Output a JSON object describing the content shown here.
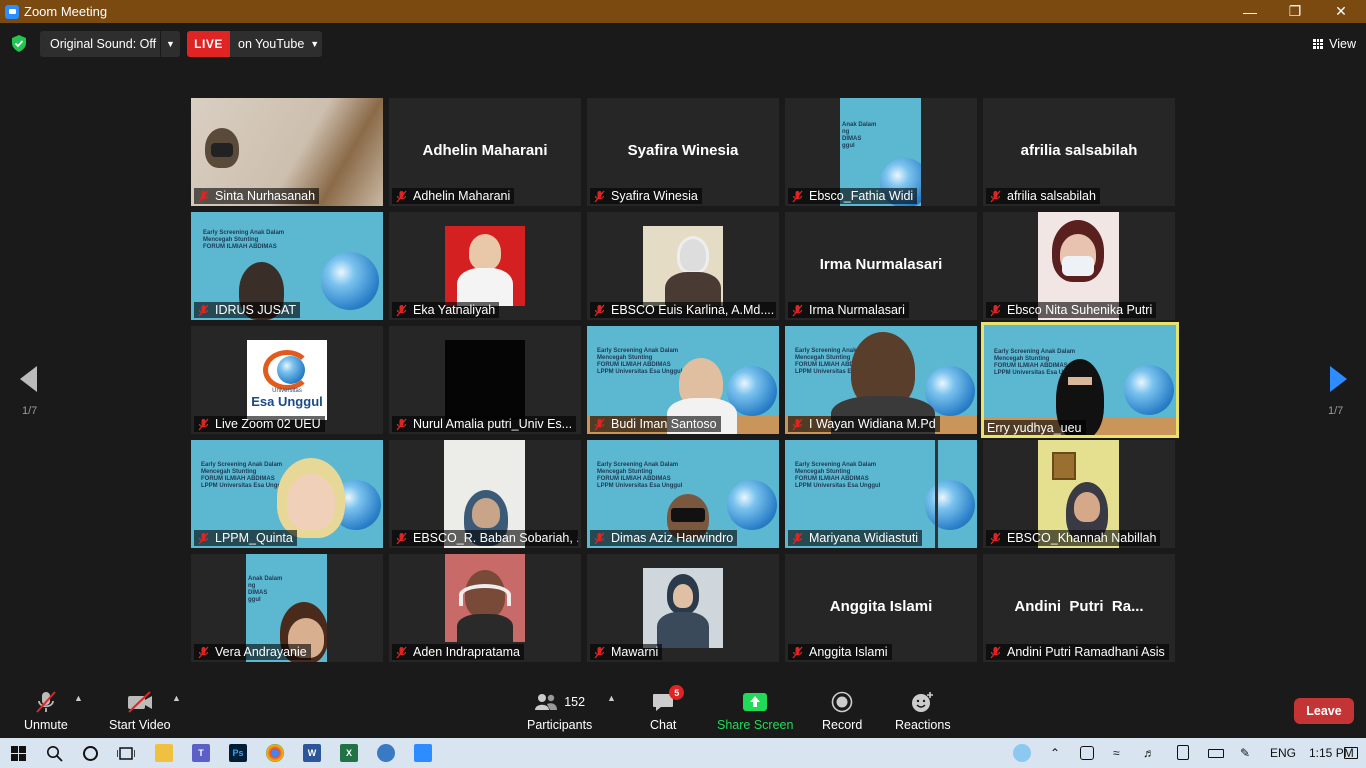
{
  "window": {
    "title": "Zoom Meeting"
  },
  "top_bar": {
    "original_sound": "Original Sound: Off",
    "live_badge": "LIVE",
    "live_target": "on YouTube",
    "view_label": "View"
  },
  "gallery": {
    "page_left": "1/7",
    "page_right": "1/7",
    "tiles": [
      {
        "name": "Sinta Nurhasanah",
        "big": ""
      },
      {
        "name": "Adhelin Maharani",
        "big": "Adhelin Maharani"
      },
      {
        "name": "Syafira Winesia",
        "big": "Syafira Winesia"
      },
      {
        "name": "Ebsco_Fathia Widi",
        "big": ""
      },
      {
        "name": "afrilia salsabilah",
        "big": "afrilia salsabilah"
      },
      {
        "name": "IDRUS JUSAT",
        "big": ""
      },
      {
        "name": "Eka Yatnaliyah",
        "big": ""
      },
      {
        "name": "EBSCO Euis Karlina, A.Md....",
        "big": ""
      },
      {
        "name": "Irma Nurmalasari",
        "big": "Irma Nurmalasari"
      },
      {
        "name": "Ebsco Nita Suhenika Putri",
        "big": ""
      },
      {
        "name": "Live Zoom 02 UEU",
        "big": ""
      },
      {
        "name": "Nurul Amalia putri_Univ Es...",
        "big": ""
      },
      {
        "name": "Budi Iman Santoso",
        "big": ""
      },
      {
        "name": "I Wayan Widiana M.Pd",
        "big": ""
      },
      {
        "name": "Erry yudhya_ueu",
        "big": ""
      },
      {
        "name": "LPPM_Quinta",
        "big": ""
      },
      {
        "name": "EBSCO_R. Baban Sobariah, ...",
        "big": ""
      },
      {
        "name": "Dimas Aziz Harwindro",
        "big": ""
      },
      {
        "name": "Mariyana Widiastuti",
        "big": ""
      },
      {
        "name": "EBSCO_Khannah Nabillah",
        "big": ""
      },
      {
        "name": "Vera Andrayanie",
        "big": ""
      },
      {
        "name": "Aden Indrapratama",
        "big": ""
      },
      {
        "name": "Mawarni",
        "big": ""
      },
      {
        "name": "Anggita Islami",
        "big": "Anggita Islami"
      },
      {
        "name": "Andini Putri Ramadhani Asis",
        "big": "Andini  Putri  Ra..."
      }
    ],
    "slide": {
      "line1": "Early Screening Anak Dalam",
      "line2": "Mencegah Stunting",
      "line3": "FORUM ILMIAH ABDIMAS",
      "line4": "LPPM Universitas Esa Unggul"
    },
    "logo": {
      "small": "Universitas",
      "big": "Esa Unggul"
    }
  },
  "toolbar": {
    "unmute": "Unmute",
    "start_video": "Start Video",
    "participants_count": "152",
    "participants": "Participants",
    "chat": "Chat",
    "chat_badge": "5",
    "share_screen": "Share Screen",
    "record": "Record",
    "reactions": "Reactions",
    "leave": "Leave"
  },
  "taskbar": {
    "lang": "ENG",
    "time": "1:15 PM"
  },
  "colors": {
    "title_bar": "#7a4a10",
    "live_red": "#e02424",
    "share_green": "#23d959",
    "active_border": "#e8e36a",
    "nav_arrow": "#2d8cff"
  }
}
